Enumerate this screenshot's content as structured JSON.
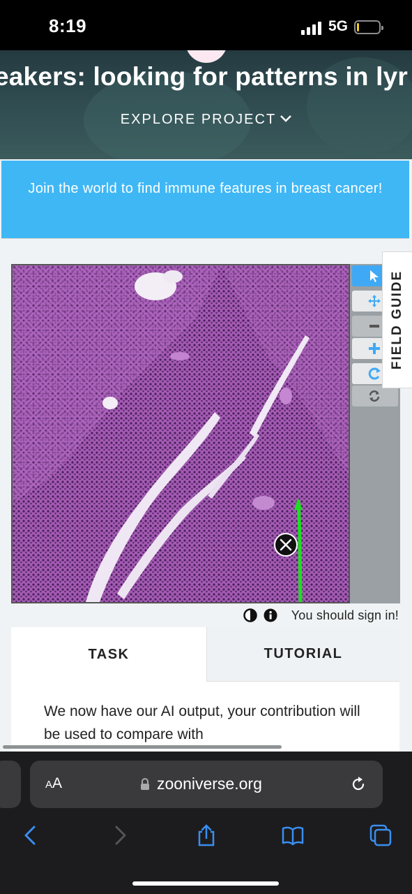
{
  "status_bar": {
    "time": "8:19",
    "network": "5G",
    "battery_level": 0.1,
    "battery_color": "#f2d21a"
  },
  "project": {
    "title": "eakers: looking for patterns in lyr",
    "explore_label": "EXPLORE PROJECT",
    "explore_icon": "chevron-down-icon"
  },
  "announcement": {
    "text": "Join the world to find immune features in breast cancer!",
    "color": "#3fb7f5"
  },
  "viewer": {
    "tools": [
      {
        "name": "pointer-tool",
        "icon": "pointer-arrow-icon",
        "active": true
      },
      {
        "name": "pan-tool",
        "icon": "move-arrows-icon",
        "active": false
      },
      {
        "name": "zoom-out-tool",
        "icon": "minus-icon",
        "active": false
      },
      {
        "name": "zoom-in-tool",
        "icon": "plus-icon",
        "active": false
      },
      {
        "name": "rotate-tool",
        "icon": "rotate-icon",
        "active": false
      },
      {
        "name": "reset-tool",
        "icon": "refresh-icon",
        "active": false
      }
    ],
    "accent_color": "#3fa9f5",
    "mark_color": "#19e01c",
    "field_guide_label": "FIELD GUIDE",
    "signin_message": "You should sign in!",
    "meta_icons": [
      "invert-colors-icon",
      "info-icon"
    ]
  },
  "task_panel": {
    "tabs": [
      "TASK",
      "TUTORIAL"
    ],
    "active_tab": "TASK",
    "instructions": "We now have our AI output, your contribution will be used to compare with"
  },
  "browser": {
    "text_size_label": "AA",
    "domain": "zooniverse.org",
    "nav_icons": [
      "back-icon",
      "forward-icon",
      "share-icon",
      "bookmarks-icon",
      "tabs-icon"
    ]
  }
}
